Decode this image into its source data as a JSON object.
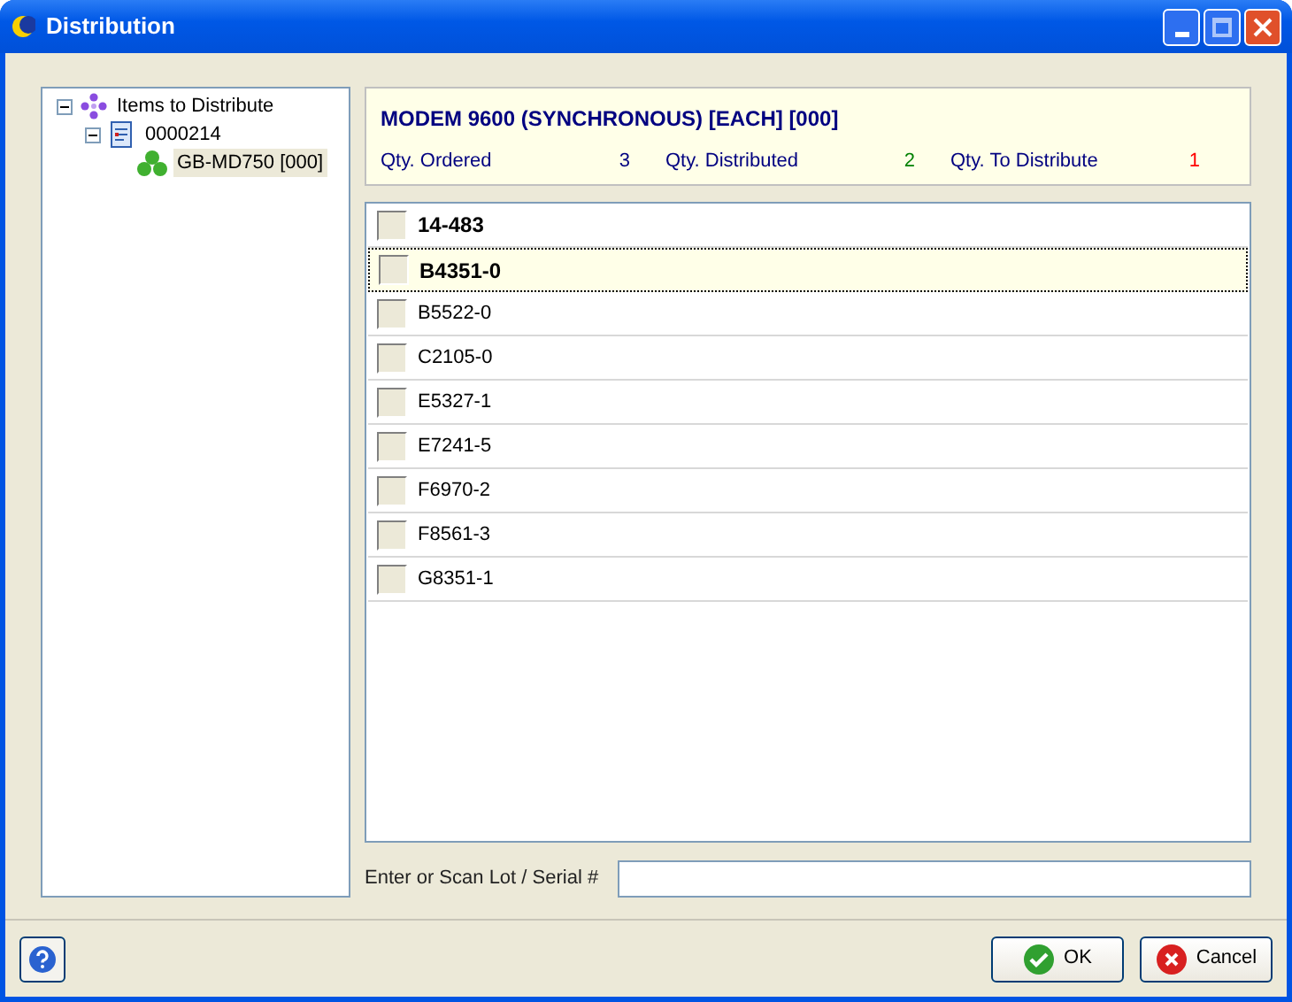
{
  "window": {
    "title": "Distribution"
  },
  "tree": [
    {
      "label": "Items to Distribute",
      "kind": "items",
      "expanded": true,
      "selected": false,
      "children": [
        {
          "label": "0000214",
          "kind": "document",
          "expanded": true,
          "selected": false,
          "children": [
            {
              "label": "GB-MD750 [000]",
              "kind": "product",
              "selected": true
            }
          ]
        }
      ]
    }
  ],
  "header": {
    "title": "MODEM 9600 (SYNCHRONOUS) [EACH] [000]",
    "quantities": [
      {
        "label": "Qty. Ordered",
        "value": "3",
        "color": "#000080"
      },
      {
        "label": "Qty. Distributed",
        "value": "2",
        "color": "#008000"
      },
      {
        "label": "Qty. To Distribute",
        "value": "1",
        "color": "#ff0000"
      }
    ]
  },
  "lots": [
    {
      "label": "14-483",
      "distributed": true,
      "selected": false
    },
    {
      "label": "B4351-0",
      "distributed": true,
      "selected": true
    },
    {
      "label": "B5522-0",
      "distributed": false,
      "selected": false
    },
    {
      "label": "C2105-0",
      "distributed": false,
      "selected": false
    },
    {
      "label": "E5327-1",
      "distributed": false,
      "selected": false
    },
    {
      "label": "E7241-5",
      "distributed": false,
      "selected": false
    },
    {
      "label": "F6970-2",
      "distributed": false,
      "selected": false
    },
    {
      "label": "F8561-3",
      "distributed": false,
      "selected": false
    },
    {
      "label": "G8351-1",
      "distributed": false,
      "selected": false
    }
  ],
  "scan": {
    "label": "Enter or Scan Lot / Serial #"
  },
  "buttons": [
    {
      "label": "OK",
      "kind": "ok"
    },
    {
      "label": "Cancel",
      "kind": "cancel"
    }
  ]
}
